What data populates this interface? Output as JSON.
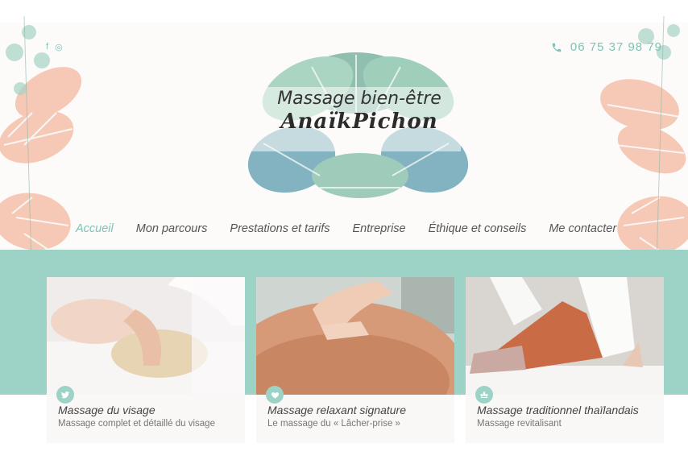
{
  "header": {
    "social": [
      {
        "icon": "facebook-icon",
        "glyph": "f"
      },
      {
        "icon": "instagram-icon",
        "glyph": "◎"
      }
    ],
    "phone": "06 75 37 98 79",
    "logo": {
      "title": "Massage bien-être",
      "name": "AnaïkPichon"
    }
  },
  "nav": [
    {
      "label": "Accueil",
      "active": true
    },
    {
      "label": "Mon parcours",
      "active": false
    },
    {
      "label": "Prestations et tarifs",
      "active": false
    },
    {
      "label": "Entreprise",
      "active": false
    },
    {
      "label": "Éthique et conseils",
      "active": false
    },
    {
      "label": "Me contacter",
      "active": false
    }
  ],
  "cards": [
    {
      "title": "Massage du visage",
      "subtitle": "Massage complet et détaillé du visage",
      "icon": "bird-icon"
    },
    {
      "title": "Massage relaxant signature",
      "subtitle": "Le massage du « Lâcher-prise »",
      "icon": "heart-icon"
    },
    {
      "title": "Massage traditionnel thaïlandais",
      "subtitle": "Massage revitalisant",
      "icon": "lotus-icon"
    }
  ],
  "colors": {
    "accent": "#9dd3c7",
    "accent_text": "#7fc2b6",
    "leaf_peach": "#f3b9a0",
    "leaf_green": "#8fc4b0",
    "leaf_blue": "#6fa7b8"
  }
}
